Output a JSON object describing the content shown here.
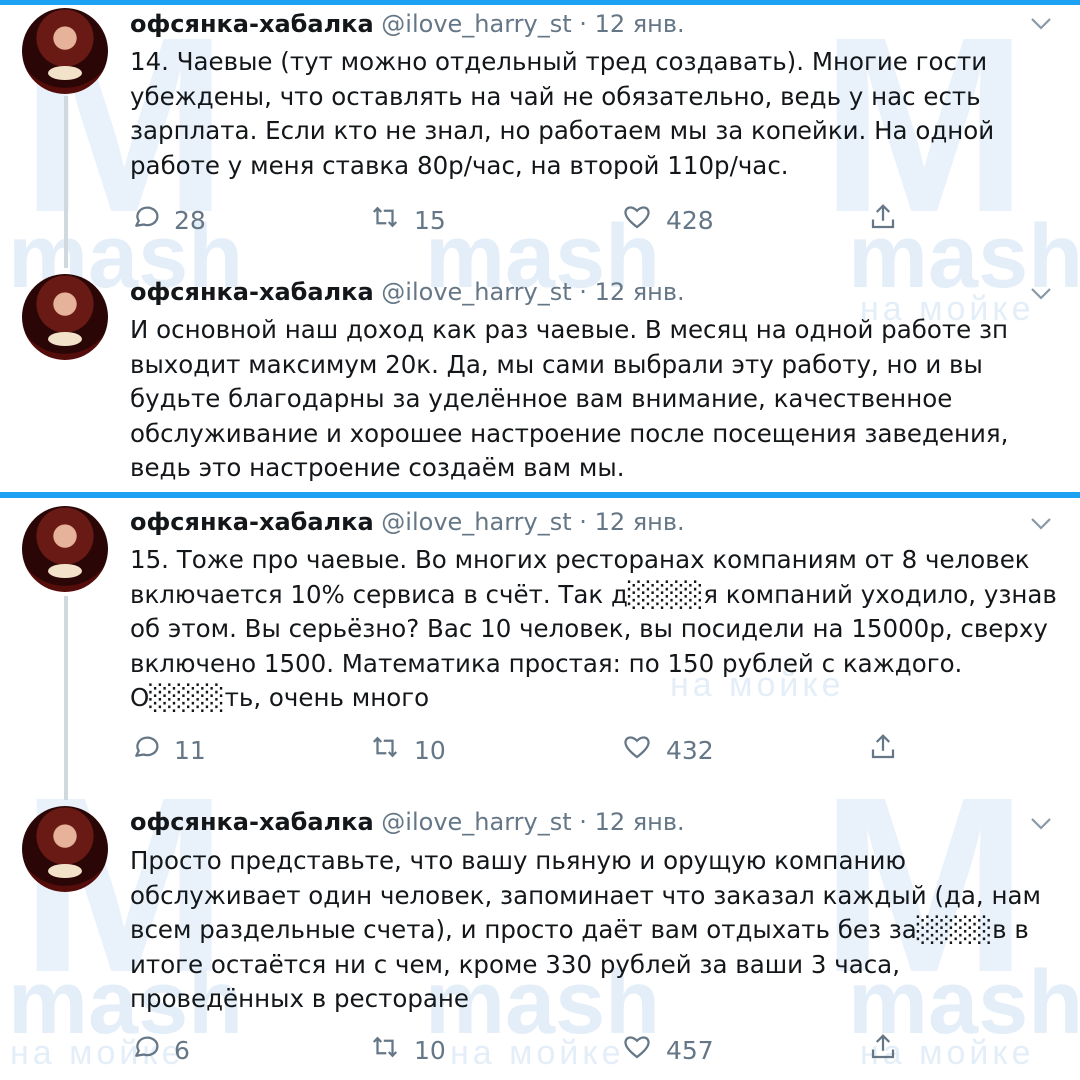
{
  "watermark": {
    "brand": "mash",
    "sub": "на мойке"
  },
  "tweets": [
    {
      "name": "офсянка-хабалка",
      "handle": "@ilove_harry_st",
      "separator": "·",
      "date": "12 янв.",
      "text": "14. Чаевые (тут можно отдельный тред создавать). Многие гости убеждены, что оставлять на чай не обязательно, ведь у нас есть зарплата. Если кто не знал, но работаем мы за копейки. На одной работе у меня ставка 80р/час, на второй 110р/час.",
      "replies": "28",
      "retweets": "15",
      "likes": "428"
    },
    {
      "name": "офсянка-хабалка",
      "handle": "@ilove_harry_st",
      "separator": "·",
      "date": "12 янв.",
      "text": "И основной наш доход как раз чаевые. В месяц на одной работе зп выходит максимум 20к. Да, мы сами выбрали эту работу, но и вы будьте благодарны за уделённое вам внимание, качественное обслуживание и хорошее настроение после посещения заведения, ведь это настроение создаём вам мы."
    },
    {
      "name": "офсянка-хабалка",
      "handle": "@ilove_harry_st",
      "separator": "·",
      "date": "12 янв.",
      "text": "15. Тоже про чаевые. Во многих ресторанах компаниям от 8 человек включается 10% сервиса в счёт. Так д░░░░я компаний уходило, узнав об этом. Вы серьёзно? Вас 10 человек, вы посидели на 15000р, сверху включено 1500. Математика простая: по 150 рублей с каждого. О░░░░ть, очень много",
      "replies": "11",
      "retweets": "10",
      "likes": "432"
    },
    {
      "name": "офсянка-хабалка",
      "handle": "@ilove_harry_st",
      "separator": "·",
      "date": "12 янв.",
      "text": "Просто представьте, что вашу пьяную и орущую компанию обслуживает один человек, запоминает что заказал каждый (да, нам всем раздельные счета), и просто даёт вам отдыхать без за░░░░в в итоге остаётся ни с чем, кроме 330 рублей за ваши 3 часа, проведённых в ресторане",
      "replies": "6",
      "retweets": "10",
      "likes": "457"
    }
  ],
  "icons": {
    "reply": "reply-icon",
    "retweet": "retweet-icon",
    "like": "heart-icon",
    "share": "share-icon",
    "menu": "chevron-down-icon"
  },
  "colors": {
    "accent_blue": "#1da1f2",
    "text": "#14171a",
    "muted": "#657786",
    "watermark": "#e4eef8"
  }
}
